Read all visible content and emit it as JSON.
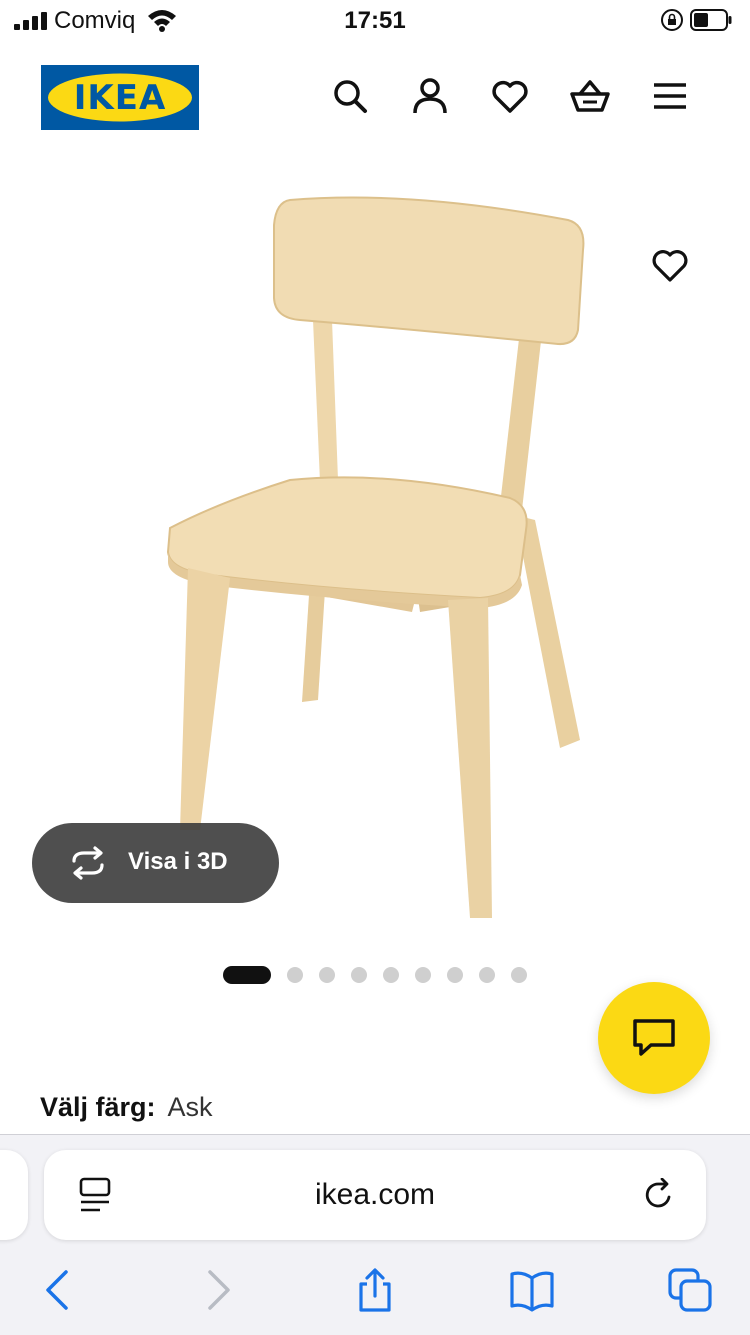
{
  "status_bar": {
    "carrier": "Comviq",
    "time": "17:51"
  },
  "header": {
    "logo_text": "IKEA",
    "icons": [
      "search-icon",
      "user-icon",
      "heart-icon",
      "basket-icon",
      "menu-icon"
    ]
  },
  "product": {
    "image_icon": "chair-image",
    "view_3d_label": "Visa i 3D",
    "carousel": {
      "total": 9,
      "active": 1
    }
  },
  "color": {
    "label": "Välj färg:",
    "value": "Ask"
  },
  "browser": {
    "url": "ikea.com"
  },
  "colors": {
    "ikea_blue": "#0058a3",
    "ikea_yellow": "#fbd914",
    "ios_blue": "#1a73e8"
  }
}
